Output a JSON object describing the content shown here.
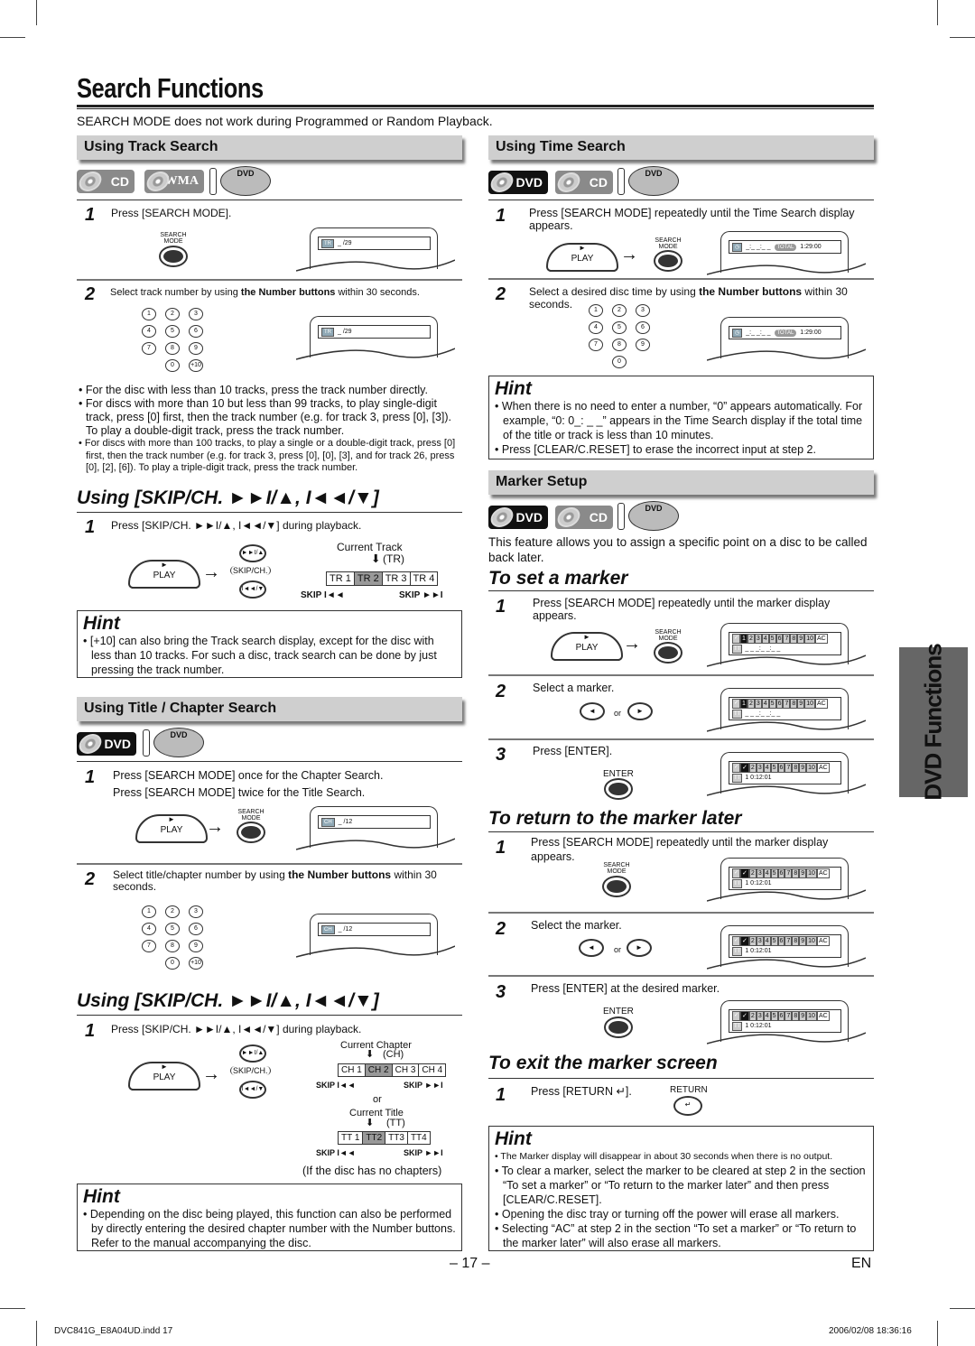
{
  "page": {
    "title": "Search Functions",
    "intro": "SEARCH MODE does not work during Programmed or Random Playback.",
    "side_tab": "DVD Functions",
    "page_number": "– 17 –",
    "language": "EN",
    "footer_left": "DVC841G_E8A04UD.indd  17",
    "footer_right": "2006/02/08   18:36:16"
  },
  "icons": {
    "cd": "CD",
    "wma": "WMA",
    "dvd": "DVD",
    "dvd_logo": "DVD"
  },
  "track_search": {
    "heading": "Using Track Search",
    "step1_text": "Press [SEARCH MODE].",
    "step1_bold": "[SEARCH MODE]",
    "step2_pre": "Select track number by using ",
    "step2_bold": "the Number buttons",
    "step2_post": " within 30 seconds.",
    "search_mode_label": "SEARCH\nMODE",
    "display_chip": "TR",
    "display_value": "_ /29",
    "numpad": [
      "1",
      "2",
      "3",
      "4",
      "5",
      "6",
      "7",
      "8",
      "9",
      "0",
      "+10"
    ],
    "bullets": [
      "For the disc with less than 10 tracks, press the track number directly.",
      "For discs with more than 10 but less than 99 tracks, to play single-digit track, press [0] first, then the track number (e.g. for track 3, press [0], [3]). To play a double-digit track, press the track number.",
      "For discs with more than 100 tracks, to play a single or a double-digit track, press [0] first, then the track number (e.g. for track 3, press [0], [0], [3], and for track 26, press [0], [2], [6]). To play a triple-digit track, press the track number."
    ]
  },
  "skip_track": {
    "heading": "Using [SKIP/CH. ►►I/▲, I◄◄/▼]",
    "step1": "Press [SKIP/CH. ►►I/▲, I◄◄/▼] during playback.",
    "play_label": "PLAY",
    "skip_ch_label": "SKIP/CH.",
    "fwd_label": "►►I/▲",
    "back_label": "I◄◄/▼",
    "current_label": "Current Track",
    "current_abbr": "(TR)",
    "strip": [
      "TR 1",
      "TR 2",
      "TR 3",
      "TR 4"
    ],
    "current_index": 1,
    "skip_back": "SKIP I◄◄",
    "skip_fwd": "SKIP ►►I",
    "hint_title": "Hint",
    "hint": [
      "[+10] can also bring the Track search display, except for the disc with less than 10 tracks. For such a disc, track search can be done by just pressing the track number."
    ]
  },
  "title_chapter": {
    "heading": "Using Title / Chapter Search",
    "step1_line1": "Press [SEARCH MODE] once for the Chapter Search.",
    "step1_line2": "Press [SEARCH MODE] twice for the Title Search.",
    "step2_pre": "Select title/chapter number by using ",
    "step2_bold": "the Number buttons",
    "step2_post": " within 30 seconds.",
    "display_chip": "CH",
    "display_value": "_ /12"
  },
  "skip_chapter": {
    "heading": "Using [SKIP/CH. ►►I/▲, I◄◄/▼]",
    "step1": "Press [SKIP/CH. ►►I/▲, I◄◄/▼] during playback.",
    "current_chapter": "Current Chapter",
    "chapter_abbr": "(CH)",
    "chapter_strip": [
      "CH 1",
      "CH 2",
      "CH 3",
      "CH 4"
    ],
    "or": "or",
    "current_title": "Current Title",
    "title_abbr": "(TT)",
    "title_strip": [
      "TT 1",
      "TT2",
      "TT3",
      "TT4"
    ],
    "no_chapters": "(If the disc has no chapters)",
    "hint_title": "Hint",
    "hint": [
      "Depending on the disc being played, this function can also be performed by directly entering the desired chapter number with the Number buttons. Refer to the manual accompanying the disc."
    ]
  },
  "time_search": {
    "heading": "Using Time Search",
    "step1": "Press [SEARCH MODE] repeatedly until the Time Search display appears.",
    "step2_pre": "Select a desired disc time by using ",
    "step2_bold": "the Number buttons",
    "step2_post": " within 30 seconds.",
    "display_time": "_:_ _:_ _",
    "total_label": "TOTAL",
    "total_time": "1:29:00",
    "numpad": [
      "1",
      "2",
      "3",
      "4",
      "5",
      "6",
      "7",
      "8",
      "9",
      "0"
    ],
    "hint_title": "Hint",
    "hint": [
      "When there is no need to enter a number, “0” appears automatically. For example, “0: 0_: _ _” appears in the Time Search display if the total time of the title or track is less than 10 minutes.",
      "Press [CLEAR/C.RESET] to erase the incorrect input at step 2."
    ]
  },
  "marker": {
    "heading": "Marker Setup",
    "intro": "This feature allows you to assign a specific point on a disc to be called back later.",
    "set_heading": "To set a marker",
    "set_steps": [
      "Press [SEARCH MODE] repeatedly until the marker display appears.",
      "Select a marker.",
      "Press [ENTER]."
    ],
    "markers": [
      "1",
      "2",
      "3",
      "4",
      "5",
      "6",
      "7",
      "8",
      "9",
      "10",
      "AC"
    ],
    "tt_chip": "TT",
    "empty_time": "_ _ _:_ _:_ _",
    "set_time": "1  0:12:01",
    "or": "or",
    "enter_label": "ENTER",
    "return_heading": "To return to the marker later",
    "return_steps": [
      "Press [SEARCH MODE] repeatedly until the marker display appears.",
      "Select the marker.",
      "Press [ENTER] at the desired marker."
    ],
    "exit_heading": "To exit the marker screen",
    "exit_step": "Press [RETURN ↵].",
    "return_label": "RETURN",
    "hint_title": "Hint",
    "hint": [
      "The Marker display will disappear in about 30 seconds when there is no output.",
      "To clear a marker, select the marker to be cleared at step 2 in the section “To set a marker” or “To return to the marker later” and then press [CLEAR/C.RESET].",
      "Opening the disc tray or turning off the power will erase all markers.",
      "Selecting “AC” at step 2 in the section “To set a marker” or “To return to the marker later” will also erase all markers."
    ]
  }
}
